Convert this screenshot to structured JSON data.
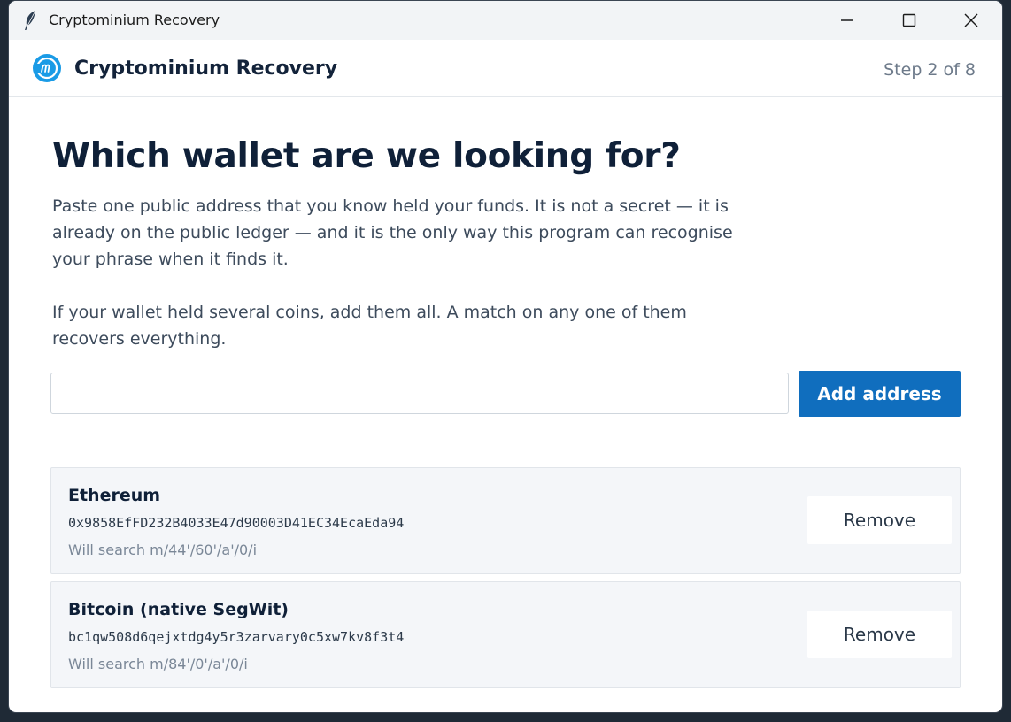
{
  "window": {
    "title": "Cryptominium Recovery",
    "title_icon": "feather-icon",
    "controls": [
      "minimize-icon",
      "maximize-icon",
      "close-icon"
    ]
  },
  "header": {
    "logo_icon": "cryptominium-logo",
    "title": "Cryptominium Recovery",
    "step": "Step 2 of 8"
  },
  "main": {
    "heading": "Which wallet are we looking for?",
    "paragraph1": "Paste one public address that you know held your funds. It is not a secret — it is already on the public ledger — and it is the only way this program can recognise your phrase when it finds it.",
    "paragraph2": "If your wallet held several coins, add them all. A match on any one of them recovers everything.",
    "address_input": {
      "value": "",
      "placeholder": ""
    },
    "add_button": "Add address"
  },
  "addresses": [
    {
      "coin": "Ethereum",
      "address": "0x9858EfFD232B4033E47d90003D41EC34EcaEda94",
      "path": "Will search m/44'/60'/a'/0/i",
      "remove_label": "Remove"
    },
    {
      "coin": "Bitcoin (native SegWit)",
      "address": "bc1qw508d6qejxtdg4y5r3zarvary0c5xw7kv8f3t4",
      "path": "Will search m/84'/0'/a'/0/i",
      "remove_label": "Remove"
    }
  ],
  "colors": {
    "accent": "#106ebe",
    "heading": "#0f2038",
    "card_bg": "#f4f6f9"
  }
}
